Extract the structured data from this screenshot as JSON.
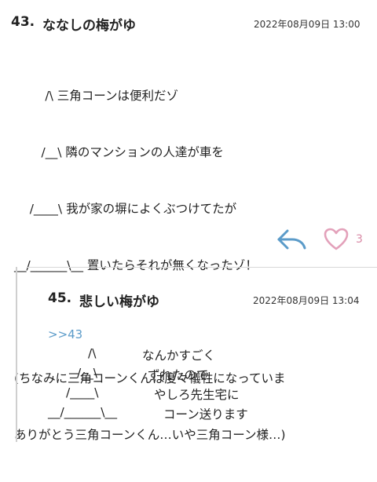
{
  "post1": {
    "number": "43.",
    "name": "ななしの梅がゆ",
    "date": "2022年08月09日 13:00",
    "lines": [
      "        /\\ 三角コーンは便利だゾ",
      "       /__\\ 隣のマンションの人達が車を",
      "    /____\\ 我が家の塀によくぶつけてたが",
      "__/______\\__ 置いたらそれが無くなったゾ！",
      "",
      "(ちなみに三角コーンくんは度々犠牲になっていま",
      "ありがとう三角コーンくん…いや三角コーン様…)"
    ],
    "reply_icon": "reply-arrow-icon",
    "like_icon": "heart-icon",
    "like_count": "3"
  },
  "post2": {
    "number": "45.",
    "name": "悲しい梅がゆ",
    "date": "2022年08月09日 13:04",
    "anchor": ">>43",
    "art": [
      "/\\",
      "/__\\",
      "/____\\",
      "__/______\\__"
    ],
    "text": [
      "なんかすごく",
      "ずれたので",
      "やしろ先生宅に",
      "コーン送ります"
    ]
  },
  "colors": {
    "accent_blue": "#5b9bc9",
    "like_pink": "#e3a1ba",
    "divider": "#d8d8d8"
  }
}
